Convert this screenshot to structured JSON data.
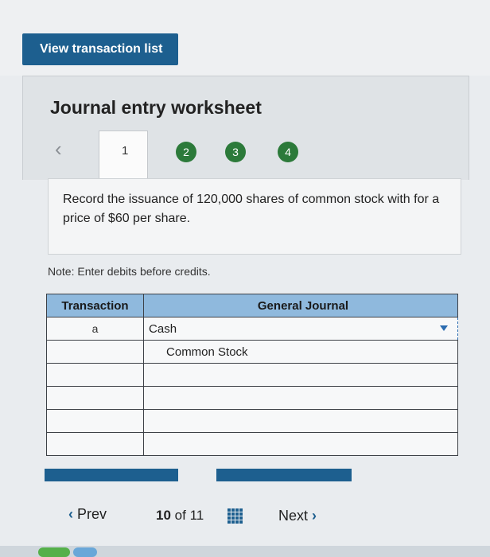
{
  "header": {
    "view_button_label": "View transaction list"
  },
  "worksheet": {
    "title": "Journal entry worksheet",
    "steps": [
      "1",
      "2",
      "3",
      "4"
    ],
    "active_step": "1"
  },
  "instruction": {
    "text": "Record the issuance of 120,000 shares of common stock with for a price of $60 per share."
  },
  "note": {
    "text": "Note: Enter debits before credits."
  },
  "table": {
    "headers": {
      "transaction": "Transaction",
      "general_journal": "General Journal"
    },
    "rows": [
      {
        "transaction": "a",
        "account": "Cash"
      },
      {
        "transaction": "",
        "account": "Common Stock"
      },
      {
        "transaction": "",
        "account": ""
      },
      {
        "transaction": "",
        "account": ""
      },
      {
        "transaction": "",
        "account": ""
      },
      {
        "transaction": "",
        "account": ""
      }
    ]
  },
  "footer": {
    "prev_label": "Prev",
    "page_current": "10",
    "page_of": "of",
    "page_total": "11",
    "next_label": "Next"
  },
  "colors": {
    "accent": "#1d5f8f",
    "step_green": "#2c7a3a",
    "table_header": "#8fb9dd"
  }
}
